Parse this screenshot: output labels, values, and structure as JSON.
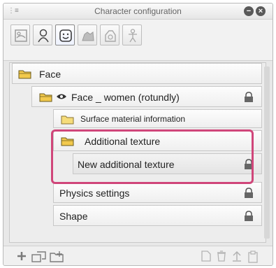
{
  "window": {
    "title": "Character configuration"
  },
  "tabs": [
    {
      "name": "texture-tab-icon"
    },
    {
      "name": "body-tab-icon"
    },
    {
      "name": "face-tab-icon"
    },
    {
      "name": "animal-tab-icon"
    },
    {
      "name": "bag-tab-icon"
    },
    {
      "name": "human-tab-icon"
    }
  ],
  "tree": {
    "rows": [
      {
        "label": "Face"
      },
      {
        "label": "Face _ women (rotundly)"
      },
      {
        "label": "Surface material information"
      },
      {
        "label": "Additional texture"
      },
      {
        "label": "New additional texture"
      },
      {
        "label": "Physics settings"
      },
      {
        "label": "Shape"
      }
    ]
  },
  "colors": {
    "highlight": "#d0467a",
    "folder": "#f2c94c"
  }
}
